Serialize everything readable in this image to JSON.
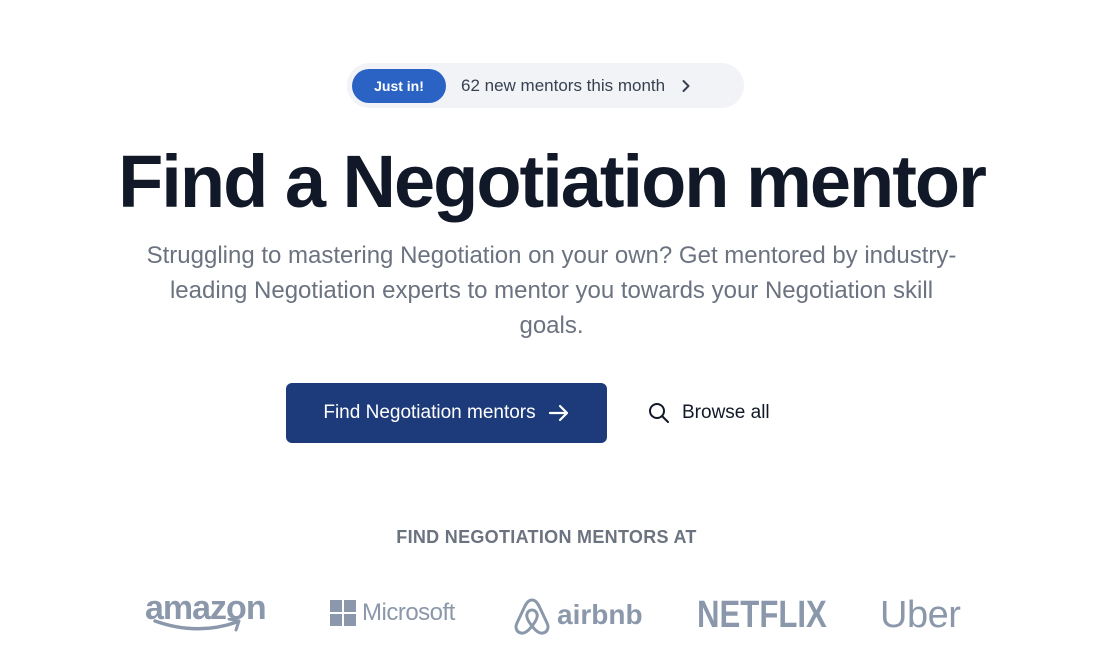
{
  "announcement": {
    "badge": "Just in!",
    "text": "62 new mentors this month",
    "chevron_icon": "chevron-right"
  },
  "hero": {
    "title": "Find a Negotiation mentor",
    "subtitle": "Struggling to mastering Negotiation on your own? Get mentored by industry-leading Negotiation experts to mentor you towards your Negotiation skill goals."
  },
  "actions": {
    "primary_label": "Find Negotiation mentors",
    "primary_icon": "arrow-right",
    "secondary_label": "Browse all",
    "secondary_icon": "search"
  },
  "companies": {
    "heading": "FIND NEGOTIATION MENTORS AT",
    "logos": [
      "amazon",
      "Microsoft",
      "airbnb",
      "NETFLIX",
      "Uber"
    ]
  },
  "colors": {
    "badge": "#2a63c4",
    "primary_button": "#1d3b7a",
    "heading": "#111827",
    "muted_text": "#6b7280",
    "logo_gray": "#8b98ab"
  }
}
